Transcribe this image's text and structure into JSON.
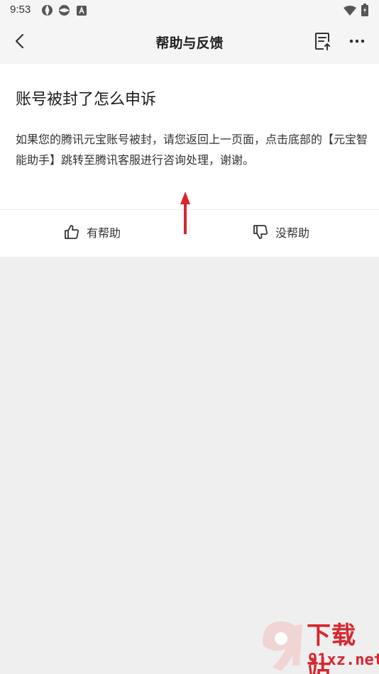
{
  "status_bar": {
    "time": "9:53",
    "icons_left": [
      "sync-icon",
      "sync-icon",
      "font-a-icon"
    ],
    "icons_right": [
      "wifi-icon",
      "battery-icon"
    ]
  },
  "nav": {
    "title": "帮助与反馈",
    "back_icon": "chevron-left-icon",
    "doc_icon": "document-upload-icon",
    "more_icon": "more-horizontal-icon"
  },
  "article": {
    "title": "账号被封了怎么申诉",
    "body": "如果您的腾讯元宝账号被封，请您返回上一页面，点击底部的【元宝智能助手】跳转至腾讯客服进行咨询处理，谢谢。"
  },
  "feedback": {
    "helpful_label": "有帮助",
    "not_helpful_label": "没帮助",
    "helpful_icon": "thumbs-up-icon",
    "not_helpful_icon": "thumbs-down-icon"
  },
  "watermark": {
    "text": "下载站",
    "site": "91xz.net"
  },
  "colors": {
    "background": "#efefef",
    "card": "#ffffff",
    "arrow": "#d7262e"
  }
}
